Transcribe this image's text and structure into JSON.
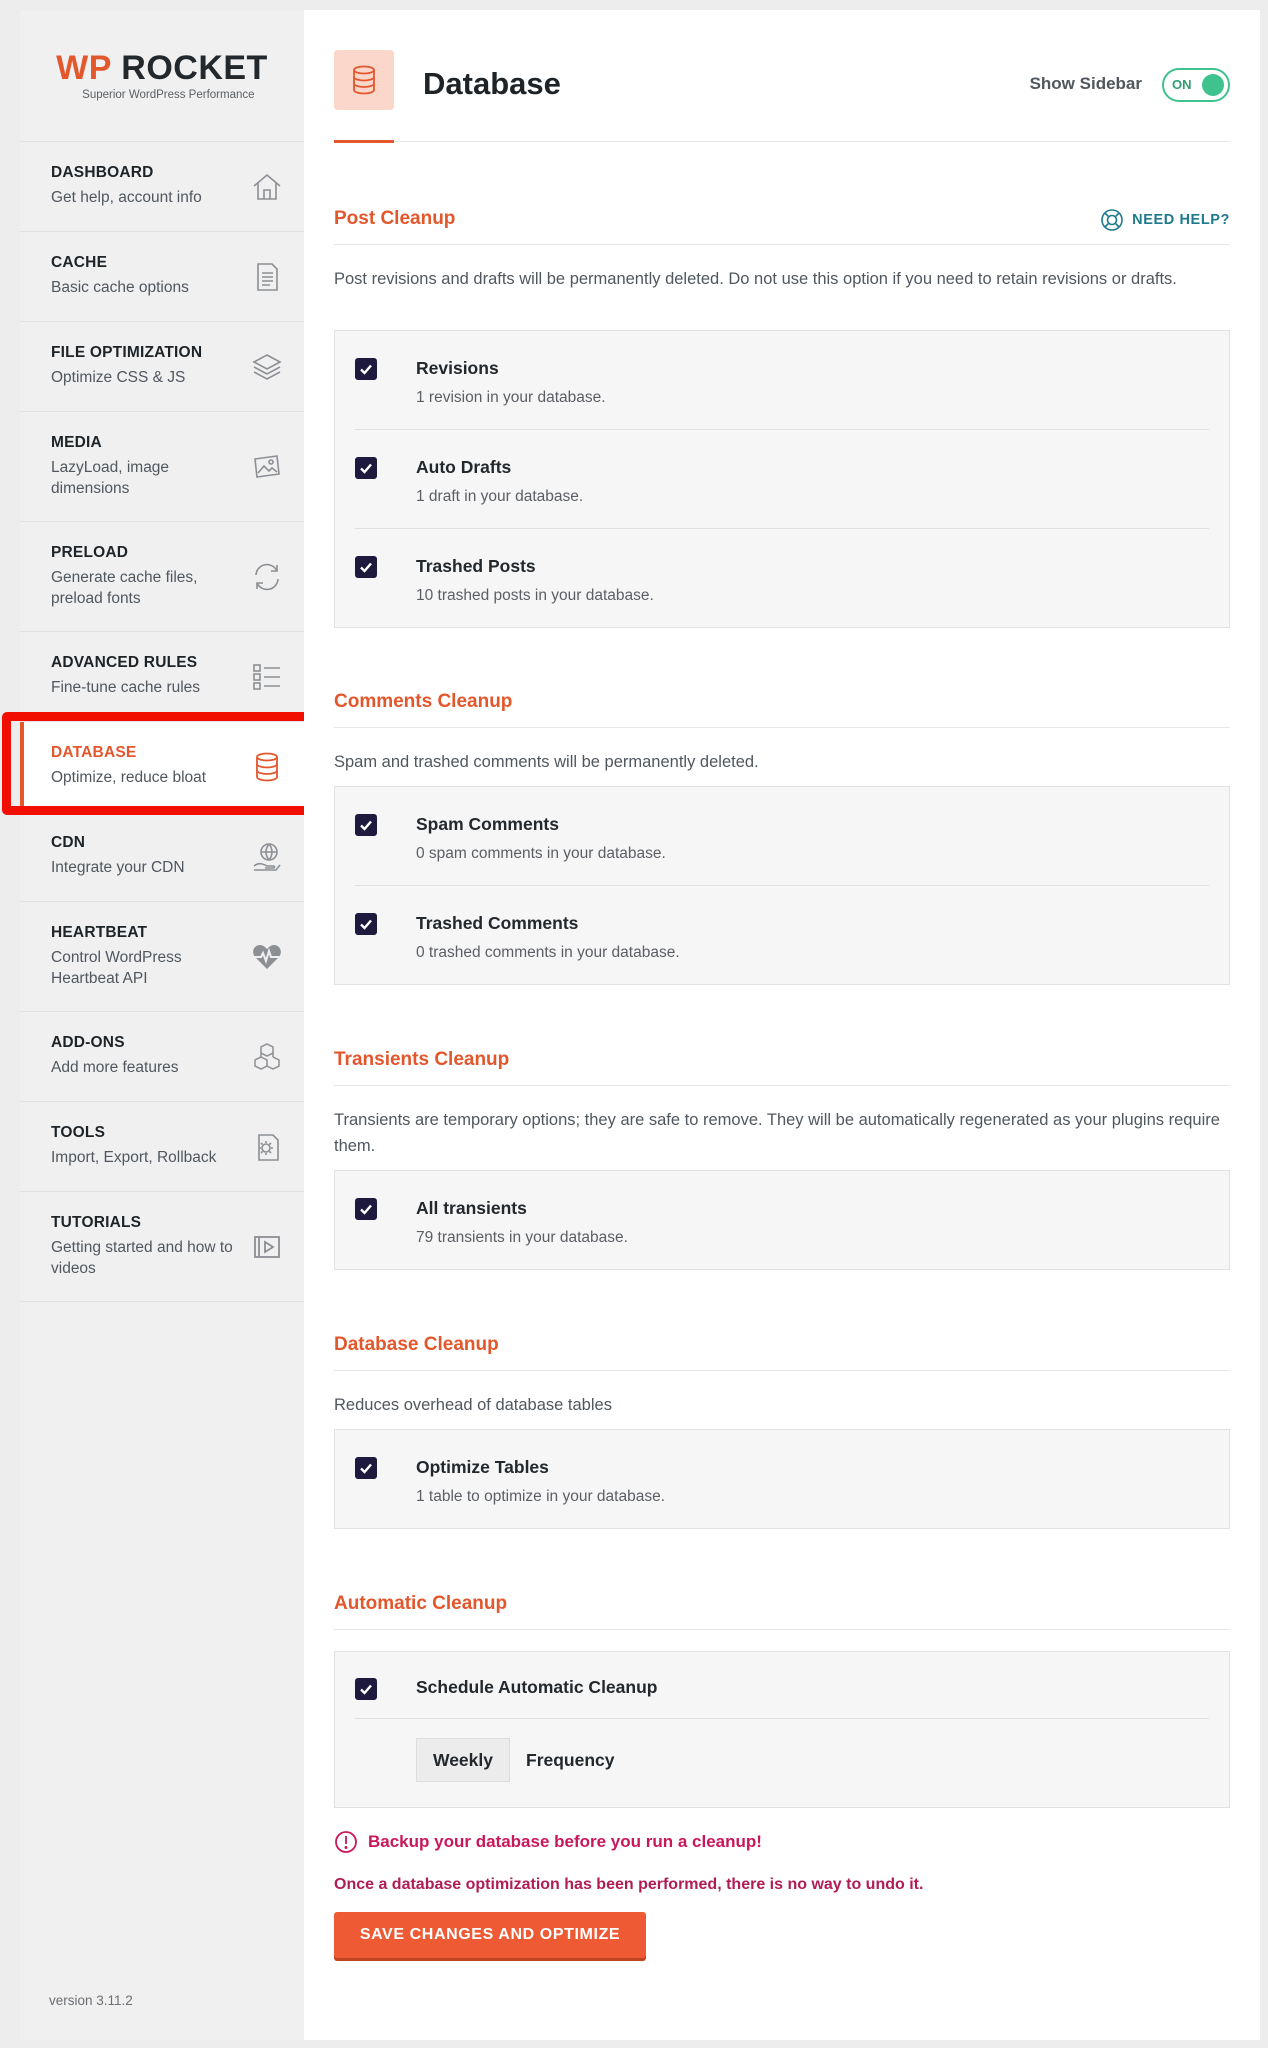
{
  "brand": {
    "name_wp": "WP",
    "name_rocket": "ROCKET",
    "tagline": "Superior WordPress Performance",
    "accent": "#e3572d"
  },
  "sidebar": {
    "items": [
      {
        "title": "DASHBOARD",
        "sub": "Get help, account info",
        "icon": "home-icon"
      },
      {
        "title": "CACHE",
        "sub": "Basic cache options",
        "icon": "document-icon"
      },
      {
        "title": "FILE OPTIMIZATION",
        "sub": "Optimize CSS & JS",
        "icon": "layers-icon"
      },
      {
        "title": "MEDIA",
        "sub": "LazyLoad, image dimensions",
        "icon": "image-icon"
      },
      {
        "title": "PRELOAD",
        "sub": "Generate cache files, preload fonts",
        "icon": "refresh-icon"
      },
      {
        "title": "ADVANCED RULES",
        "sub": "Fine-tune cache rules",
        "icon": "list-icon"
      },
      {
        "title": "DATABASE",
        "sub": "Optimize, reduce bloat",
        "icon": "database-icon",
        "active": true
      },
      {
        "title": "CDN",
        "sub": "Integrate your CDN",
        "icon": "globe-hand-icon"
      },
      {
        "title": "HEARTBEAT",
        "sub": "Control WordPress Heartbeat API",
        "icon": "heartbeat-icon"
      },
      {
        "title": "ADD-ONS",
        "sub": "Add more features",
        "icon": "cubes-icon"
      },
      {
        "title": "TOOLS",
        "sub": "Import, Export, Rollback",
        "icon": "tools-icon"
      },
      {
        "title": "TUTORIALS",
        "sub": "Getting started and how to videos",
        "icon": "play-icon"
      }
    ],
    "version": "version 3.11.2"
  },
  "header": {
    "title": "Database",
    "show_sidebar_label": "Show Sidebar",
    "toggle_state": "ON"
  },
  "need_help": "NEED HELP?",
  "sections": {
    "post": {
      "title": "Post Cleanup",
      "desc": "Post revisions and drafts will be permanently deleted. Do not use this option if you need to retain revisions or drafts.",
      "options": [
        {
          "label": "Revisions",
          "sub": "1 revision in your database.",
          "checked": true
        },
        {
          "label": "Auto Drafts",
          "sub": "1 draft in your database.",
          "checked": true
        },
        {
          "label": "Trashed Posts",
          "sub": "10 trashed posts in your database.",
          "checked": true
        }
      ]
    },
    "comments": {
      "title": "Comments Cleanup",
      "desc": "Spam and trashed comments will be permanently deleted.",
      "options": [
        {
          "label": "Spam Comments",
          "sub": "0 spam comments in your database.",
          "checked": true
        },
        {
          "label": "Trashed Comments",
          "sub": "0 trashed comments in your database.",
          "checked": true
        }
      ]
    },
    "transients": {
      "title": "Transients Cleanup",
      "desc": "Transients are temporary options; they are safe to remove. They will be automatically regenerated as your plugins require them.",
      "options": [
        {
          "label": "All transients",
          "sub": "79 transients in your database.",
          "checked": true
        }
      ]
    },
    "database": {
      "title": "Database Cleanup",
      "desc": "Reduces overhead of database tables",
      "options": [
        {
          "label": "Optimize Tables",
          "sub": "1 table to optimize in your database.",
          "checked": true
        }
      ]
    },
    "automatic": {
      "title": "Automatic Cleanup",
      "option": {
        "label": "Schedule Automatic Cleanup",
        "checked": true
      },
      "frequency_value": "Weekly",
      "frequency_label": "Frequency"
    }
  },
  "warning": "Backup your database before you run a cleanup!",
  "warning_note": "Once a database optimization has been performed, there is no way to undo it.",
  "save_button": "SAVE CHANGES AND OPTIMIZE"
}
